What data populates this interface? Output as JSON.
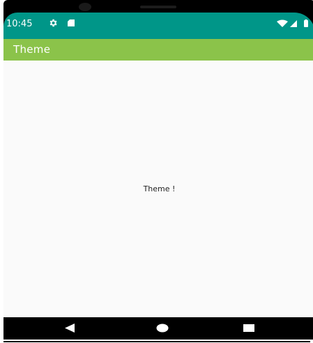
{
  "status_bar": {
    "time": "10:45",
    "icons": [
      "gear-icon",
      "sd-card-icon",
      "wifi-icon",
      "signal-icon",
      "battery-icon"
    ],
    "color": "#009688"
  },
  "app_bar": {
    "title": "Theme",
    "color": "#8bc34a"
  },
  "main": {
    "text": "Theme !",
    "background": "#fafafa"
  },
  "nav_bar": {
    "icons": [
      "back-icon",
      "home-icon",
      "recents-icon"
    ]
  }
}
